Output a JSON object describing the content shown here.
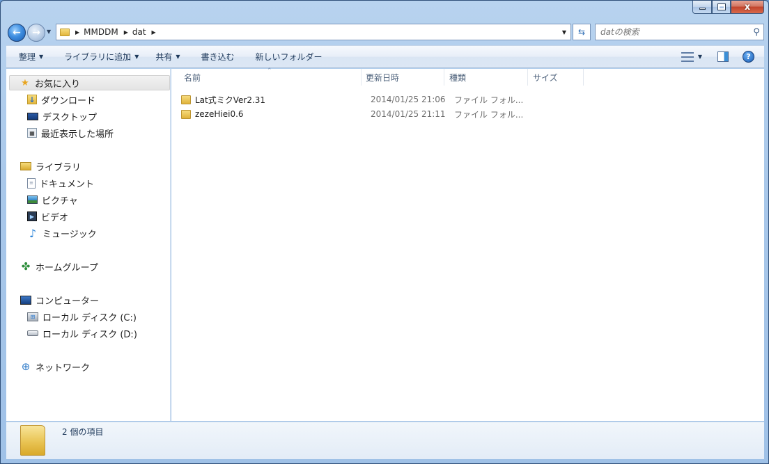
{
  "window": {
    "min_label": "",
    "max_label": "",
    "close_label": "x"
  },
  "address": {
    "crumbs": [
      "MMDDM",
      "dat"
    ]
  },
  "search": {
    "placeholder": "datの検索"
  },
  "toolbar": {
    "organize": "整理",
    "add_to_library": "ライブラリに追加",
    "share": "共有",
    "burn": "書き込む",
    "new_folder": "新しいフォルダー"
  },
  "sidebar": {
    "favorites": "お気に入り",
    "downloads": "ダウンロード",
    "desktop": "デスクトップ",
    "recent": "最近表示した場所",
    "libraries": "ライブラリ",
    "documents": "ドキュメント",
    "pictures": "ピクチャ",
    "videos": "ビデオ",
    "music": "ミュージック",
    "homegroup": "ホームグループ",
    "computer": "コンピューター",
    "disk_c": "ローカル ディスク (C:)",
    "disk_d": "ローカル ディスク (D:)",
    "network": "ネットワーク"
  },
  "columns": {
    "name": "名前",
    "date": "更新日時",
    "type": "種類",
    "size": "サイズ"
  },
  "files": [
    {
      "name": "Lat式ミクVer2.31",
      "date": "2014/01/25 21:06",
      "type": "ファイル フォル..."
    },
    {
      "name": "zezeHiei0.6",
      "date": "2014/01/25 21:11",
      "type": "ファイル フォル..."
    }
  ],
  "status": {
    "count": "2 個の項目"
  }
}
